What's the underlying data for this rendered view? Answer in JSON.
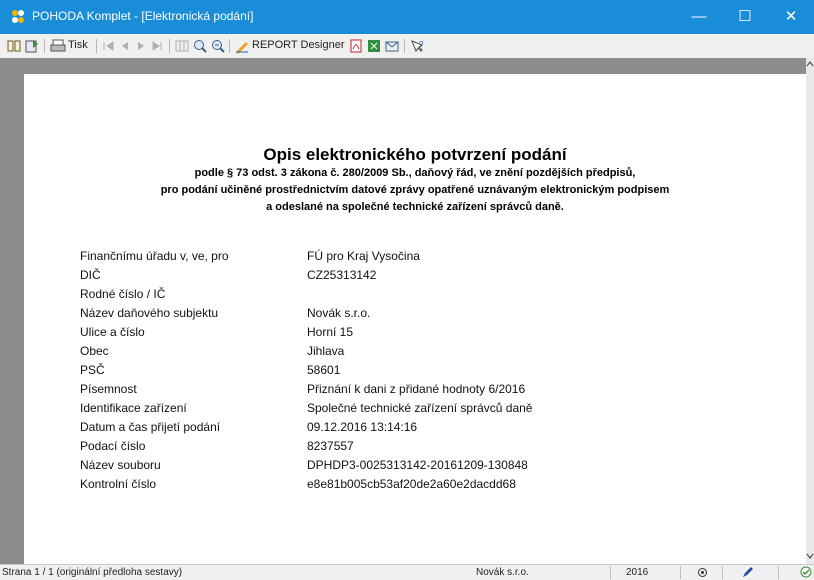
{
  "window": {
    "title": "POHODA Komplet - [Elektronická podání]",
    "minimize_glyph": "—",
    "maximize_glyph": "☐",
    "close_glyph": "✕"
  },
  "toolbar": {
    "print_label": "Tisk",
    "report_label": "REPORT Designer"
  },
  "document": {
    "title": "Opis elektronického potvrzení podání",
    "subtitle_lines": [
      "podle § 73 odst. 3 zákona č. 280/2009 Sb., daňový řád, ve znění pozdějších předpisů,",
      "pro podání učiněné prostřednictvím datové zprávy opatřené uznávaným elektronickým podpisem",
      "a odeslané na společné technické zařízení správců daně."
    ],
    "rows": [
      {
        "label": "Finančnímu úřadu v, ve, pro",
        "value": "FÚ pro Kraj Vysočina"
      },
      {
        "label": "DIČ",
        "value": "CZ25313142"
      },
      {
        "label": "Rodné číslo / IČ",
        "value": ""
      },
      {
        "label": "Název daňového subjektu",
        "value": "Novák s.r.o."
      },
      {
        "label": "Ulice a číslo",
        "value": "Horní 15"
      },
      {
        "label": "Obec",
        "value": "Jihlava"
      },
      {
        "label": "PSČ",
        "value": "58601"
      },
      {
        "label": "Písemnost",
        "value": "Přiznání k dani z přidané hodnoty 6/2016"
      },
      {
        "label": "Identifikace zařízení",
        "value": "Společné technické zařízení správců daně"
      },
      {
        "label": "Datum a čas přijetí podání",
        "value": "09.12.2016 13:14:16"
      },
      {
        "label": "Podací číslo",
        "value": "8237557"
      },
      {
        "label": "Název souboru",
        "value": "DPHDP3-0025313142-20161209-130848"
      },
      {
        "label": "Kontrolní číslo",
        "value": "e8e81b005cb53af20de2a60e2dacdd68"
      }
    ]
  },
  "status": {
    "page_info": "Strana 1 / 1  (originální předloha sestavy)",
    "company": "Novák s.r.o.",
    "year": "2016"
  },
  "colors": {
    "titlebar": "#1a8dd8",
    "viewer_bg": "#8c8c8c"
  }
}
